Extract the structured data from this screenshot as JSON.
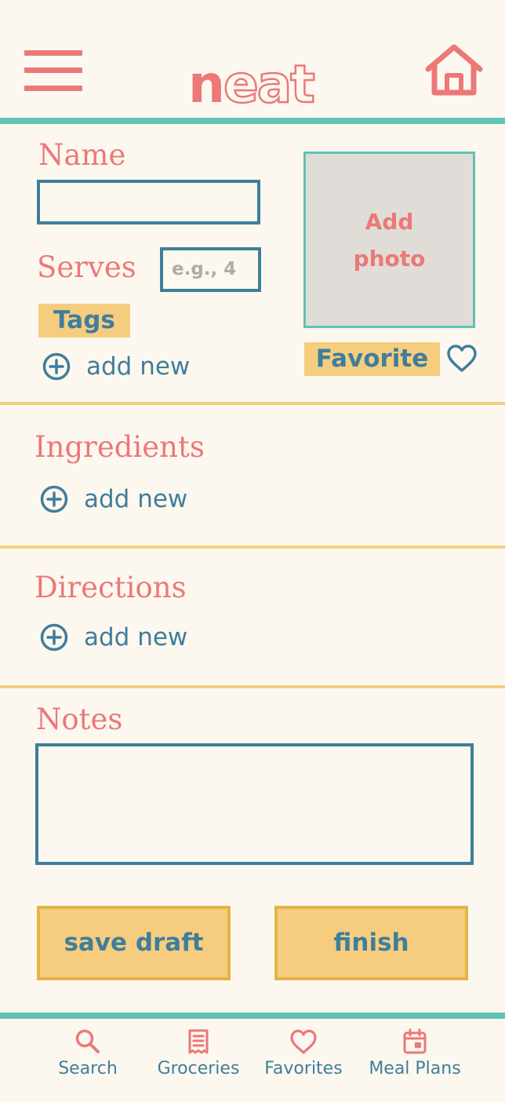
{
  "header": {
    "logo_part1": "n",
    "logo_part2": "eat"
  },
  "form": {
    "name_label": "Name",
    "name_value": "",
    "serves_label": "Serves",
    "serves_placeholder": "e.g., 4",
    "tags_label": "Tags",
    "tags_add_label": "add new",
    "photo_label": "Add photo",
    "favorite_label": "Favorite",
    "favorite_checked": false
  },
  "ingredients": {
    "title": "Ingredients",
    "add_label": "add new"
  },
  "directions": {
    "title": "Directions",
    "add_label": "add new"
  },
  "notes": {
    "title": "Notes",
    "value": ""
  },
  "actions": {
    "save_draft_label": "save draft",
    "finish_label": "finish"
  },
  "bottom_nav": {
    "items": [
      {
        "label": "Search",
        "icon": "search-icon"
      },
      {
        "label": "Groceries",
        "icon": "receipt-icon"
      },
      {
        "label": "Favorites",
        "icon": "heart-icon"
      },
      {
        "label": "Meal Plans",
        "icon": "calendar-icon"
      }
    ]
  },
  "colors": {
    "background": "#fdf8ef",
    "coral": "#ec7878",
    "teal": "#5fc3b5",
    "blue": "#3f7e9c",
    "gold": "#f6cd7e",
    "gold_border": "#e3b446"
  }
}
